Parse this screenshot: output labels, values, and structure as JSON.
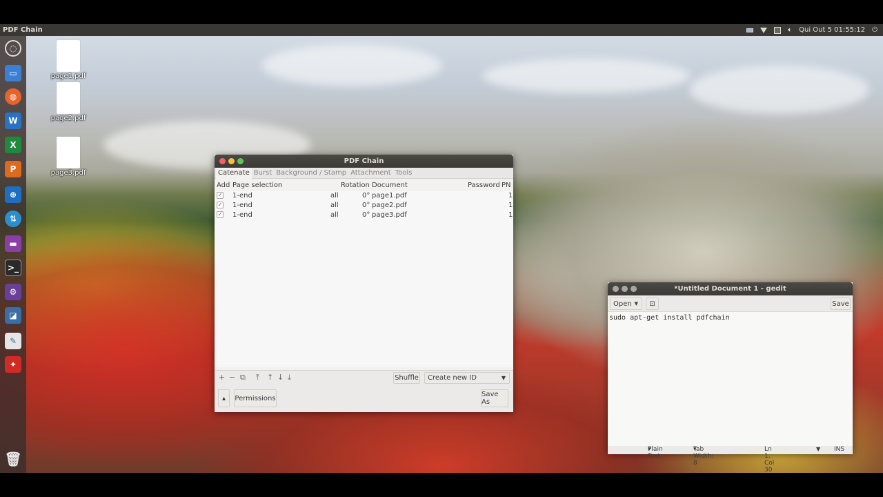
{
  "top_panel": {
    "app_title": "PDF Chain",
    "clock": "Qui Out  5 01:55:12"
  },
  "launcher": {
    "items": [
      "ubuntu-dash-icon",
      "files-icon",
      "firefox-icon",
      "writer-icon",
      "calc-icon",
      "impress-icon",
      "software-icon",
      "network-icon",
      "video-icon",
      "terminal-icon",
      "mixer-icon",
      "settings-icon",
      "text-editor-icon",
      "pdf-reader-icon",
      "trash-icon"
    ]
  },
  "desktop_files": [
    {
      "label": "page1.pdf"
    },
    {
      "label": "page2.pdf"
    },
    {
      "label": "page3.pdf"
    }
  ],
  "pdfchain": {
    "title": "PDF Chain",
    "tabs": [
      "Catenate",
      "Burst",
      "Background / Stamp",
      "Attachment",
      "Tools"
    ],
    "columns": {
      "add": "Add",
      "page_selection": "Page selection",
      "rotation": "Rotation",
      "document": "Document",
      "password": "Password",
      "pn": "PN"
    },
    "rows": [
      {
        "page_selection": "1-end",
        "even_odd": "all",
        "rotation": "0°",
        "document": "page1.pdf",
        "pn": "1"
      },
      {
        "page_selection": "1-end",
        "even_odd": "all",
        "rotation": "0°",
        "document": "page2.pdf",
        "pn": "1"
      },
      {
        "page_selection": "1-end",
        "even_odd": "all",
        "rotation": "0°",
        "document": "page3.pdf",
        "pn": "1"
      }
    ],
    "toolbar": {
      "add": "+",
      "remove": "−",
      "copy": "⧉",
      "top": "⤒",
      "up": "↑",
      "down": "↓",
      "bottom": "⤓",
      "shuffle": "Shuffle",
      "id_mode": "Create new ID"
    },
    "bottom": {
      "expander": "▴",
      "permissions": "Permissions",
      "save_as": "Save As"
    }
  },
  "gedit": {
    "title": "*Untitled Document 1 - gedit",
    "open": "Open",
    "save": "Save",
    "content": "sudo apt-get install pdfchain",
    "status": {
      "language": "Plain Text",
      "tab_width": "Tab Width: 8",
      "position": "Ln 1, Col 30",
      "mode": "INS"
    }
  }
}
